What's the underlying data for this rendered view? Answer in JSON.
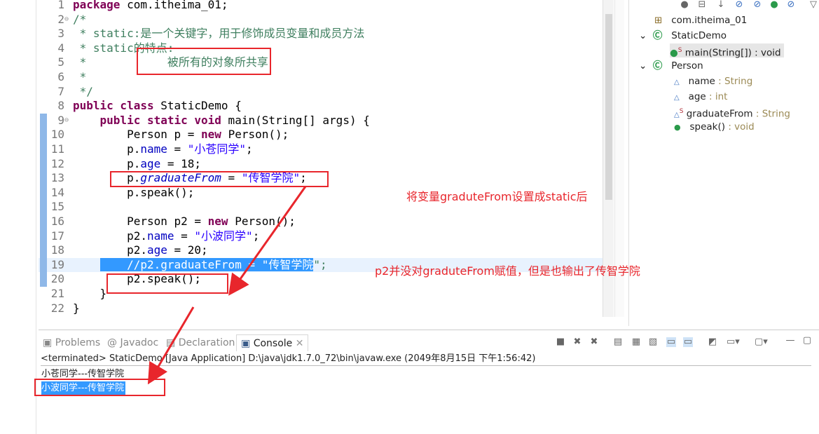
{
  "editor": {
    "lines": [
      {
        "n": "1",
        "segs": [
          [
            "package",
            "kw"
          ],
          [
            " com.itheima_01;",
            "pl"
          ]
        ]
      },
      {
        "n": "2",
        "fold": true,
        "segs": [
          [
            "/*",
            "cm"
          ]
        ]
      },
      {
        "n": "3",
        "segs": [
          [
            " * static:是一个关键字，用于修饰成员变量和成员方法",
            "cm"
          ]
        ]
      },
      {
        "n": "4",
        "segs": [
          [
            " * static的特点:",
            "cm"
          ]
        ]
      },
      {
        "n": "5",
        "segs": [
          [
            " *            被所有的对象所共享",
            "cm"
          ]
        ]
      },
      {
        "n": "6",
        "segs": [
          [
            " *",
            "cm"
          ]
        ]
      },
      {
        "n": "7",
        "segs": [
          [
            " */",
            "cm"
          ]
        ]
      },
      {
        "n": "8",
        "segs": [
          [
            "public class",
            "kw"
          ],
          [
            " StaticDemo {",
            "pl"
          ]
        ]
      },
      {
        "n": "9",
        "fold": true,
        "segs": [
          [
            "    ",
            "pl"
          ],
          [
            "public static void",
            "kw"
          ],
          [
            " main(String[] args) {",
            "pl"
          ]
        ]
      },
      {
        "n": "10",
        "segs": [
          [
            "        Person p = ",
            "pl"
          ],
          [
            "new",
            "kw"
          ],
          [
            " Person();",
            "pl"
          ]
        ]
      },
      {
        "n": "11",
        "segs": [
          [
            "        p.",
            "pl"
          ],
          [
            "name",
            "fld"
          ],
          [
            " = ",
            "pl"
          ],
          [
            "\"小苍同学\"",
            "str"
          ],
          [
            ";",
            "pl"
          ]
        ]
      },
      {
        "n": "12",
        "segs": [
          [
            "        p.",
            "pl"
          ],
          [
            "age",
            "fld"
          ],
          [
            " = 18;",
            "pl"
          ]
        ]
      },
      {
        "n": "13",
        "warn": true,
        "segs": [
          [
            "        p.",
            "pl"
          ],
          [
            "graduateFrom",
            "sfld"
          ],
          [
            " = ",
            "pl"
          ],
          [
            "\"传智学院\"",
            "str"
          ],
          [
            ";",
            "pl"
          ]
        ]
      },
      {
        "n": "14",
        "segs": [
          [
            "        p.speak();",
            "pl"
          ]
        ]
      },
      {
        "n": "15",
        "segs": [
          [
            "",
            "pl"
          ]
        ]
      },
      {
        "n": "16",
        "segs": [
          [
            "        Person p2 = ",
            "pl"
          ],
          [
            "new",
            "kw"
          ],
          [
            " Person();",
            "pl"
          ]
        ]
      },
      {
        "n": "17",
        "segs": [
          [
            "        p2.",
            "pl"
          ],
          [
            "name",
            "fld"
          ],
          [
            " = ",
            "pl"
          ],
          [
            "\"小波同学\"",
            "str"
          ],
          [
            ";",
            "pl"
          ]
        ]
      },
      {
        "n": "18",
        "segs": [
          [
            "        p2.",
            "pl"
          ],
          [
            "age",
            "fld"
          ],
          [
            " = 20;",
            "pl"
          ]
        ]
      },
      {
        "n": "19",
        "current": true,
        "segs": [
          [
            "    ",
            "pl"
          ],
          [
            "    //p2.graduateFrom = \"传智学院",
            "sel"
          ],
          [
            "\";",
            "cm"
          ]
        ]
      },
      {
        "n": "20",
        "segs": [
          [
            "        p2.speak();",
            "pl"
          ]
        ]
      },
      {
        "n": "21",
        "segs": [
          [
            "    }",
            "pl"
          ]
        ]
      },
      {
        "n": "22",
        "segs": [
          [
            "}",
            "pl"
          ]
        ]
      }
    ]
  },
  "outline": {
    "package": "com.itheima_01",
    "class1": "StaticDemo",
    "main_name": "main(String[])",
    "main_type": " : void",
    "class2": "Person",
    "fields": [
      {
        "name": "name",
        "type": " : String",
        "static": false
      },
      {
        "name": "age",
        "type": " : int",
        "static": false
      },
      {
        "name": "graduateFrom",
        "type": " : String",
        "static": true
      }
    ],
    "speak_name": "speak()",
    "speak_type": " : void",
    "static_marker": "S"
  },
  "console": {
    "tabs": [
      "Problems",
      "Javadoc",
      "Declaration",
      "Console"
    ],
    "status": "<terminated> StaticDemo [Java Application] D:\\java\\jdk1.7.0_72\\bin\\javaw.exe (2049年8月15日 下午1:56:42)",
    "output": [
      "小苍同学---传智学院",
      "小波同学---传智学院"
    ]
  },
  "annotations": {
    "note1": "将变量graduteFrom设置成static后",
    "note2": "p2并没对graduteFrom赋值，但是也输出了传智学院",
    "color": "#e8262c"
  }
}
